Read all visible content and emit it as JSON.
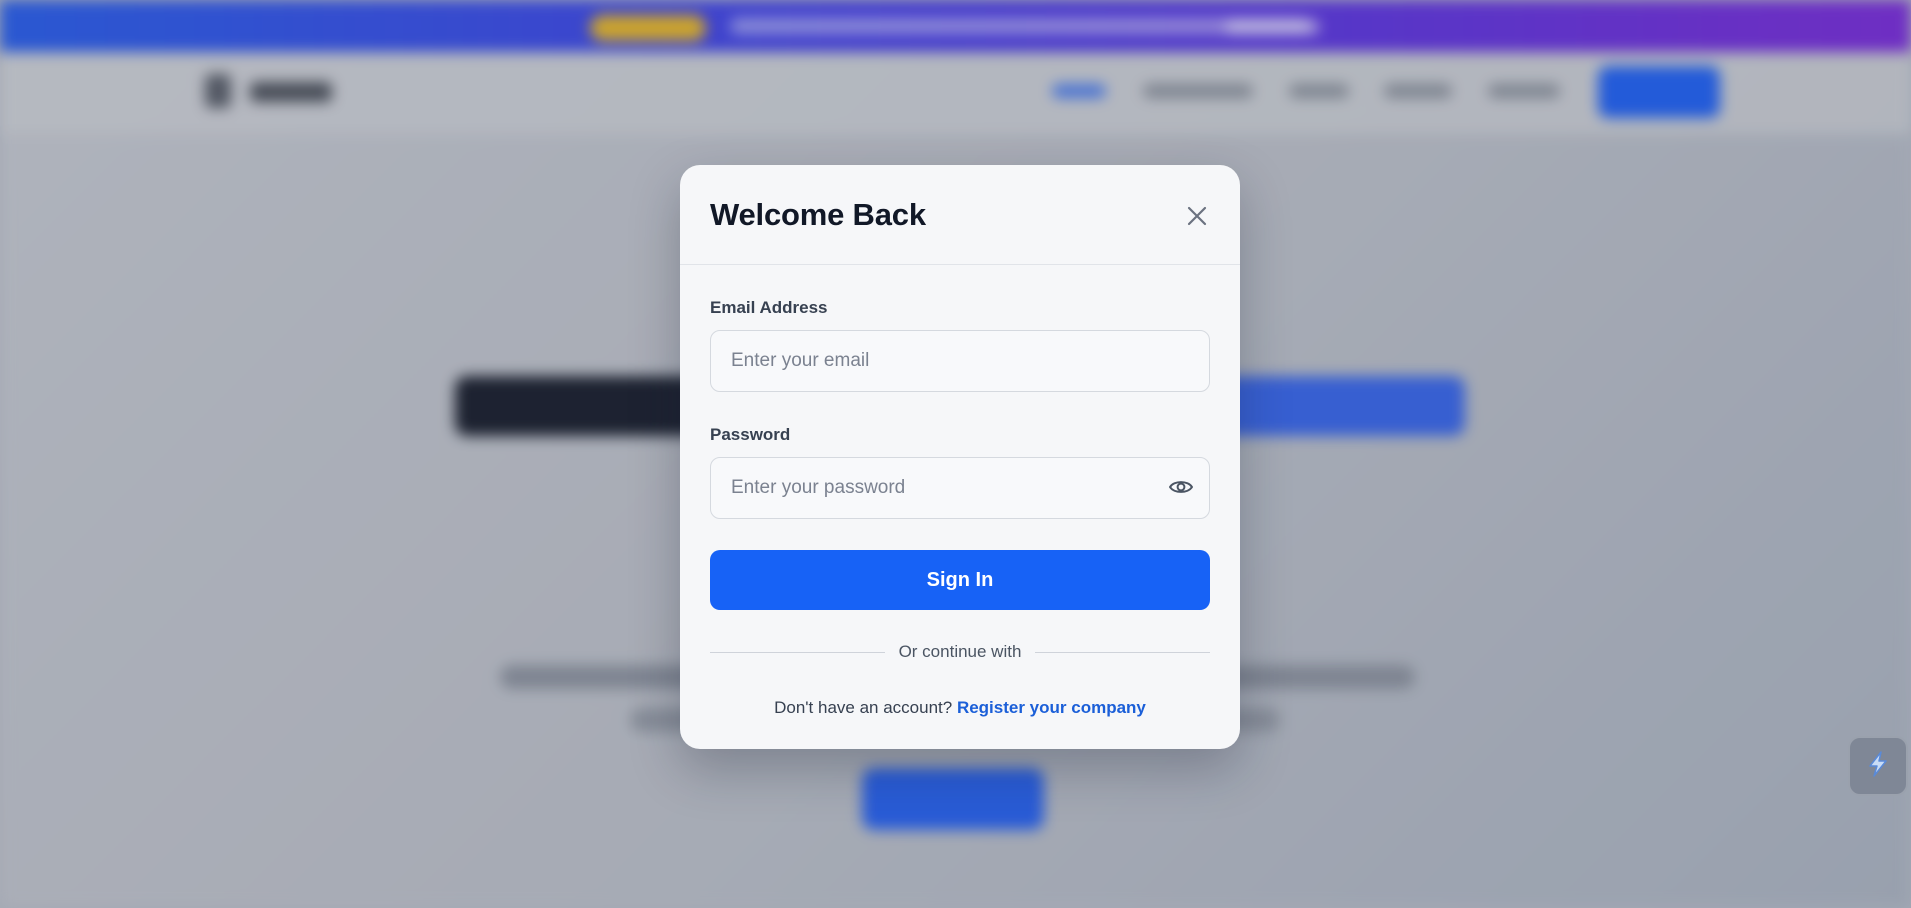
{
  "modal": {
    "title": "Welcome Back",
    "email_label": "Email Address",
    "email_placeholder": "Enter your email",
    "email_value": "",
    "password_label": "Password",
    "password_placeholder": "Enter your password",
    "password_value": "",
    "signin_label": "Sign In",
    "divider_text": "Or continue with",
    "register_prompt": "Don't have an account?",
    "register_link": "Register your company"
  },
  "icons": {
    "close": "close-icon",
    "toggle_password": "eye-icon",
    "widget": "lightning-icon"
  },
  "colors": {
    "primary": "#1762f6",
    "link": "#1b5fd8",
    "title": "#111827",
    "promo_gradient_start": "#2c5fe6",
    "promo_gradient_end": "#7a2fd6"
  }
}
